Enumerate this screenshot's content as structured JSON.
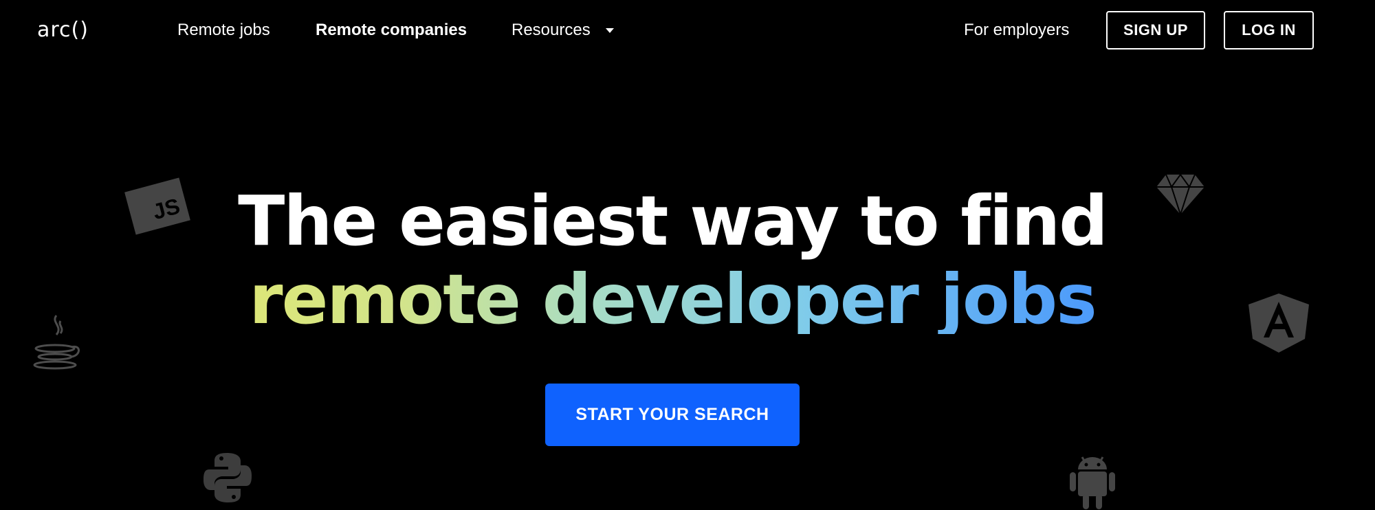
{
  "nav": {
    "logo": "arc()",
    "links": {
      "remote_jobs": "Remote jobs",
      "remote_companies": "Remote companies",
      "resources": "Resources"
    },
    "for_employers": "For employers",
    "sign_up": "SIGN UP",
    "log_in": "LOG IN"
  },
  "hero": {
    "line1": "The easiest way to find",
    "line2": "remote developer jobs",
    "cta": "START YOUR SEARCH"
  },
  "icons": [
    "javascript-icon",
    "java-icon",
    "python-icon",
    "sketch-icon",
    "angular-icon",
    "android-icon"
  ],
  "colors": {
    "background": "#000000",
    "cta": "#0f62fe",
    "gradient": [
      "#ecea5a",
      "#a6dcc8",
      "#7fcbea",
      "#3b7ff7"
    ]
  }
}
